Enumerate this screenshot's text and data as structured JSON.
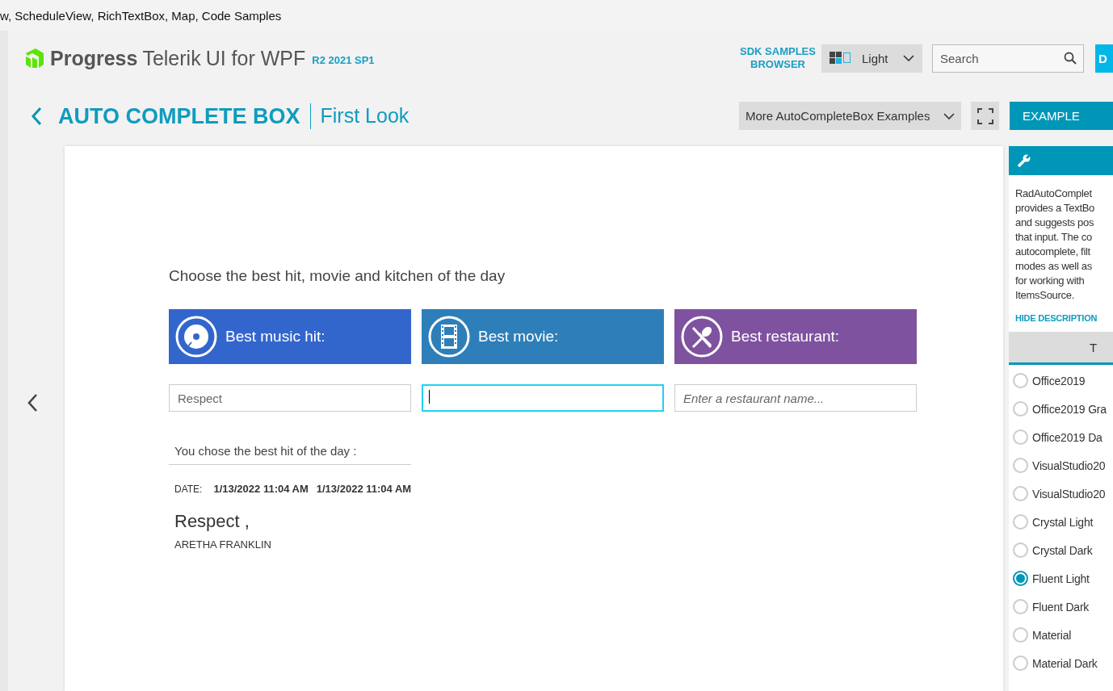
{
  "window_strip": {
    "text": "w, ScheduleView, RichTextBox, Map, Code Samples"
  },
  "header": {
    "brand": "Progress",
    "product": "Telerik",
    "product_suffix": "UI for WPF",
    "version": "R2 2021 SP1",
    "sdk_link": "SDK SAMPLES BROWSER",
    "theme_dropdown": "Light",
    "search": {
      "placeholder": "Search"
    },
    "edge_button": "D"
  },
  "title_bar": {
    "control": "AUTO COMPLETE BOX",
    "example": "First Look",
    "examples_dropdown": "More AutoCompleteBox Examples",
    "mode_button": "EXAMPLE"
  },
  "demo": {
    "heading": "Choose the best hit, movie and kitchen of the day",
    "categories": [
      {
        "kind": "disc",
        "label": "Best music hit:",
        "color": "#3366cc",
        "field": {
          "value": "Respect",
          "focused": false
        }
      },
      {
        "kind": "film",
        "label": "Best movie:",
        "color": "#2e7fb9",
        "field": {
          "focused": true
        }
      },
      {
        "kind": "cutlery",
        "label": "Best restaurant:",
        "color": "#7f52a0",
        "field": {
          "placeholder": "Enter a restaurant name...",
          "focused": false
        }
      }
    ],
    "result": {
      "caption": "You chose the best hit of the day :",
      "date_label": "DATE:",
      "dates": [
        "1/13/2022 11:04 AM",
        "1/13/2022 11:04 AM"
      ],
      "song": "Respect ,",
      "artist": "ARETHA FRANKLIN"
    }
  },
  "side_panel": {
    "description": [
      "RadAutoComplet",
      "provides a TextBo",
      "and suggests pos",
      "that input. The co",
      "autocomplete, filt",
      "modes as well as",
      "for working with",
      "ItemsSource."
    ],
    "hide_link": "HIDE DESCRIPTION",
    "tab": "T",
    "themes": [
      {
        "label": "Office2019",
        "selected": false
      },
      {
        "label": "Office2019 Gra",
        "selected": false
      },
      {
        "label": "Office2019 Da",
        "selected": false
      },
      {
        "label": "VisualStudio20",
        "selected": false
      },
      {
        "label": "VisualStudio20",
        "selected": false
      },
      {
        "label": "Crystal Light",
        "selected": false
      },
      {
        "label": "Crystal Dark",
        "selected": false
      },
      {
        "label": "Fluent Light",
        "selected": true
      },
      {
        "label": "Fluent Dark",
        "selected": false
      },
      {
        "label": "Material",
        "selected": false
      },
      {
        "label": "Material Dark",
        "selected": false
      }
    ]
  }
}
